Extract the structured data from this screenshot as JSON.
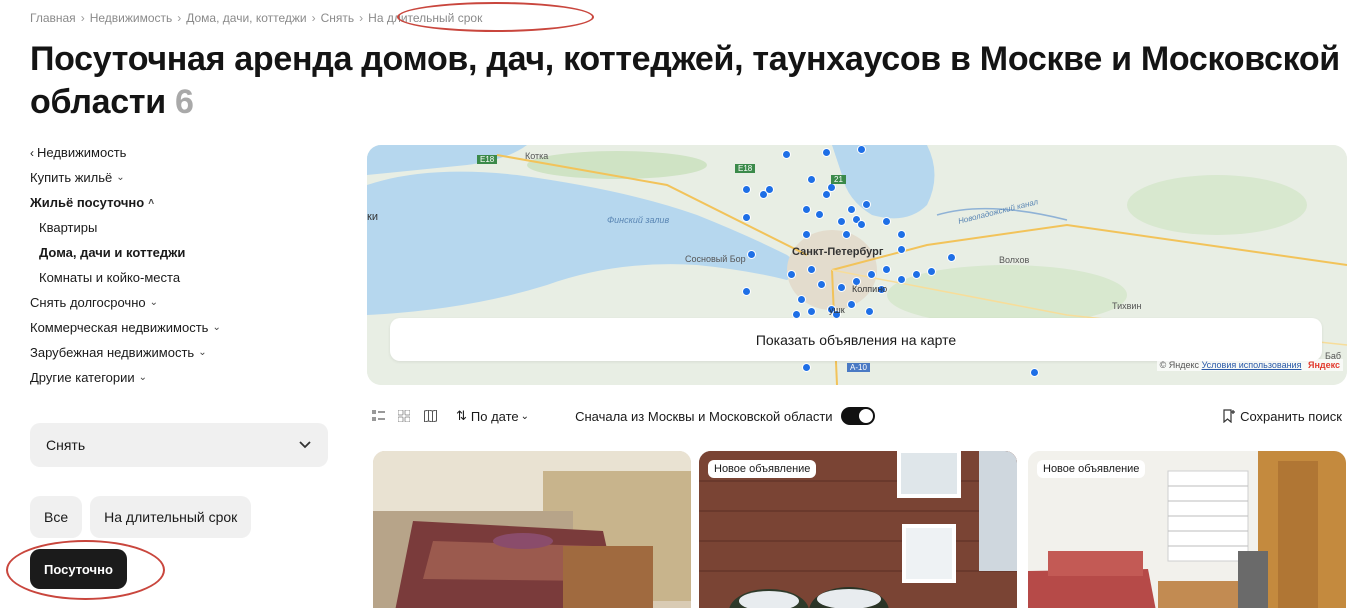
{
  "breadcrumb": [
    "Главная",
    "Недвижимость",
    "Дома, дачи, коттеджи",
    "Снять",
    "На длительный срок"
  ],
  "page": {
    "title": "Посуточная аренда домов, дач, коттеджей, таунхаусов в Москве и Московской области",
    "count": "6"
  },
  "sidebar": {
    "back_label": "Недвижимость",
    "items": [
      {
        "label": "Купить жильё",
        "chevron": "down",
        "bold": false,
        "sub": false
      },
      {
        "label": "Жильё посуточно",
        "chevron": "up",
        "bold": true,
        "sub": false
      },
      {
        "label": "Квартиры",
        "chevron": "",
        "bold": false,
        "sub": true
      },
      {
        "label": "Дома, дачи и коттеджи",
        "chevron": "",
        "bold": true,
        "sub": true
      },
      {
        "label": "Комнаты и койко-места",
        "chevron": "",
        "bold": false,
        "sub": true
      },
      {
        "label": "Снять долгосрочно",
        "chevron": "down",
        "bold": false,
        "sub": false
      },
      {
        "label": "Коммерческая недвижимость",
        "chevron": "down",
        "bold": false,
        "sub": false
      },
      {
        "label": "Зарубежная недвижимость",
        "chevron": "down",
        "bold": false,
        "sub": false
      },
      {
        "label": "Другие категории",
        "chevron": "down",
        "bold": false,
        "sub": false
      }
    ]
  },
  "filters": {
    "deal_select": "Снять",
    "period_options": [
      "Все",
      "На длительный срок"
    ],
    "period_active": "Посуточно"
  },
  "map": {
    "button_label": "Показать объявления на карте",
    "labels": {
      "gulf": "Финский залив",
      "city": "Санкт-Петербург",
      "sosnovy_bor": "Сосновый Бор",
      "kolpino": "Колпино",
      "volkhov": "Волхов",
      "tikhvin": "Тихвин",
      "kotka": "Котка",
      "left_edge": "ки",
      "bab": "Баб",
      "pushkin": "ушк",
      "canal": "Новоладожский канал",
      "road1": "E18",
      "road2": "E18",
      "road3": "21",
      "road4": "А-10"
    },
    "copyright": "© Яндекс",
    "terms": "Условия использования",
    "logo": "Яндекс",
    "pin_color": "#1e6fe6"
  },
  "toolbar": {
    "view_icons": [
      "list-view-icon",
      "grid-view-icon",
      "map-view-icon"
    ],
    "sort_label": "По дате",
    "moscow_first_label": "Сначала из Москвы и Московской области",
    "moscow_first_on": true,
    "save_search_label": "Сохранить поиск"
  },
  "listings": [
    {
      "badge": ""
    },
    {
      "badge": "Новое объявление"
    },
    {
      "badge": "Новое объявление"
    }
  ],
  "colors": {
    "annotation": "#c9463d",
    "active_pill": "#1b1b1b",
    "pill": "#f0f0f0"
  }
}
